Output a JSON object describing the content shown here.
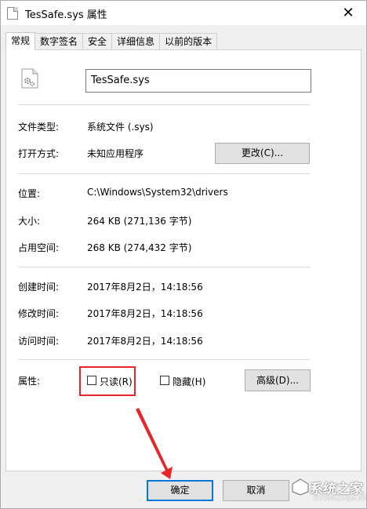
{
  "window": {
    "title": "TesSafe.sys 属性",
    "close_symbol": "✕"
  },
  "tabs": [
    {
      "label": "常规",
      "active": true
    },
    {
      "label": "数字签名",
      "active": false
    },
    {
      "label": "安全",
      "active": false
    },
    {
      "label": "详细信息",
      "active": false
    },
    {
      "label": "以前的版本",
      "active": false
    }
  ],
  "general": {
    "file_name": "TesSafe.sys",
    "file_type_label": "文件类型:",
    "file_type_value": "系统文件 (.sys)",
    "open_with_label": "打开方式:",
    "open_with_value": "未知应用程序",
    "change_button": "更改(C)...",
    "location_label": "位置:",
    "location_value": "C:\\Windows\\System32\\drivers",
    "size_label": "大小:",
    "size_value": "264 KB (271,136 字节)",
    "size_on_disk_label": "占用空间:",
    "size_on_disk_value": "268 KB (274,432 字节)",
    "created_label": "创建时间:",
    "created_value": "2017年8月2日，14:18:56",
    "modified_label": "修改时间:",
    "modified_value": "2017年8月2日，14:18:56",
    "accessed_label": "访问时间:",
    "accessed_value": "2017年8月2日，14:18:56",
    "attributes_label": "属性:",
    "readonly_label": "只读(R)",
    "readonly_checked": false,
    "hidden_label": "隐藏(H)",
    "hidden_checked": false,
    "advanced_button": "高级(D)..."
  },
  "footer": {
    "ok_button": "确定",
    "cancel_button": "取消"
  },
  "annotation": {
    "highlight_color": "#e8262a",
    "arrow_color": "#e8262a"
  },
  "watermark": {
    "text": "系统之家",
    "url": "XITONGZHIJIA.NET"
  },
  "icons": [
    "file-gear-icon",
    "close-icon",
    "checkbox-icon",
    "arrow-annotation"
  ]
}
